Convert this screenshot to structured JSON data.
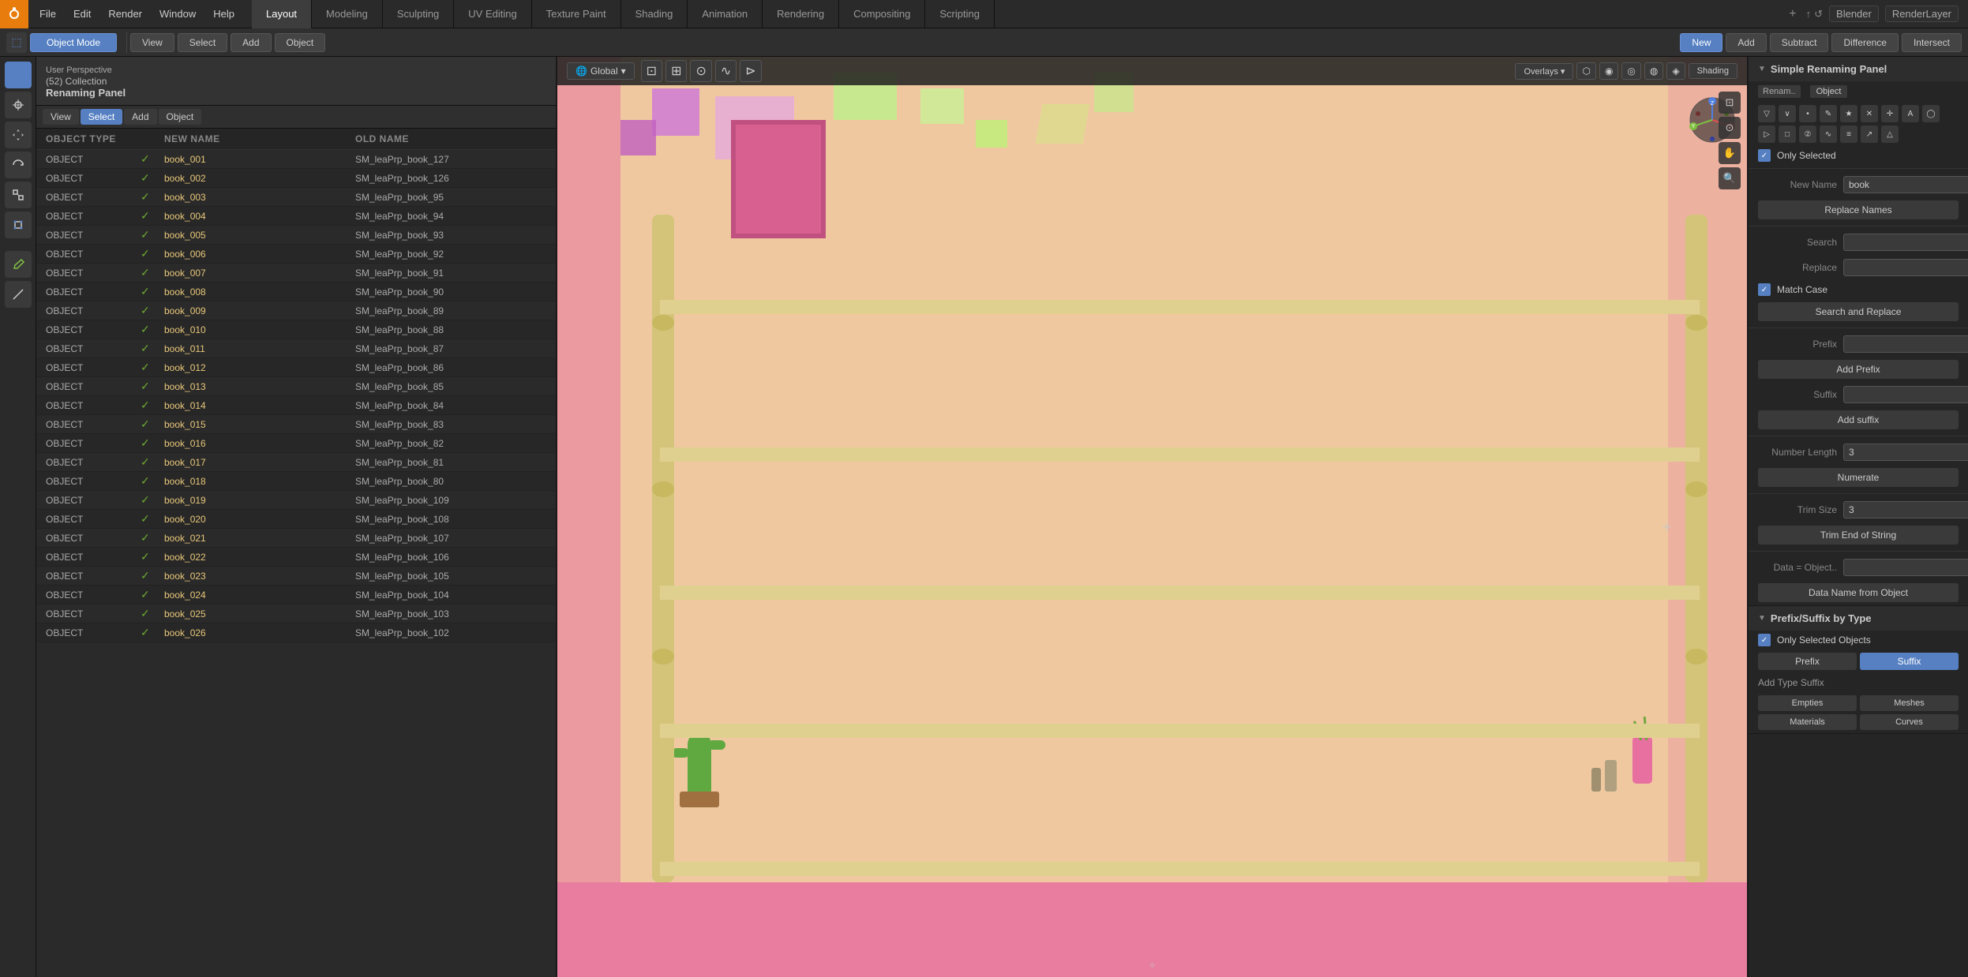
{
  "app": {
    "icon": "🟠",
    "title": "Blender"
  },
  "top_menu": {
    "items": [
      "File",
      "Edit",
      "Render",
      "Window",
      "Help"
    ]
  },
  "workspace_tabs": [
    {
      "label": "Layout",
      "active": true
    },
    {
      "label": "Modeling"
    },
    {
      "label": "Sculpting"
    },
    {
      "label": "UV Editing"
    },
    {
      "label": "Texture Paint"
    },
    {
      "label": "Shading"
    },
    {
      "label": "Animation"
    },
    {
      "label": "Rendering"
    },
    {
      "label": "Compositing"
    },
    {
      "label": "Scripting"
    }
  ],
  "header_toolbar": {
    "buttons": [
      {
        "label": "New",
        "active": true
      },
      {
        "label": "Add",
        "active": false
      },
      {
        "label": "Subtract",
        "active": false
      },
      {
        "label": "Difference",
        "active": false
      },
      {
        "label": "Intersect",
        "active": false
      }
    ]
  },
  "mode_selector": {
    "label": "Object Mode"
  },
  "view_buttons": [
    "View",
    "Select",
    "Add",
    "Object"
  ],
  "renaming_panel": {
    "header": "Renaming Panel",
    "collection_label": "(52) Collection",
    "perspective_label": "User Perspective",
    "view_buttons": [
      "View",
      "Select",
      "Add",
      "Object"
    ],
    "table_headers": {
      "object_type": "OBJECT TYPE",
      "new_name": "NEW NAME",
      "old_name": "OLD NAME"
    },
    "rows": [
      {
        "type": "OBJECT",
        "new_name": "book_001",
        "old_name": "SM_leaPrp_book_127"
      },
      {
        "type": "OBJECT",
        "new_name": "book_002",
        "old_name": "SM_leaPrp_book_126"
      },
      {
        "type": "OBJECT",
        "new_name": "book_003",
        "old_name": "SM_leaPrp_book_95"
      },
      {
        "type": "OBJECT",
        "new_name": "book_004",
        "old_name": "SM_leaPrp_book_94"
      },
      {
        "type": "OBJECT",
        "new_name": "book_005",
        "old_name": "SM_leaPrp_book_93"
      },
      {
        "type": "OBJECT",
        "new_name": "book_006",
        "old_name": "SM_leaPrp_book_92"
      },
      {
        "type": "OBJECT",
        "new_name": "book_007",
        "old_name": "SM_leaPrp_book_91"
      },
      {
        "type": "OBJECT",
        "new_name": "book_008",
        "old_name": "SM_leaPrp_book_90"
      },
      {
        "type": "OBJECT",
        "new_name": "book_009",
        "old_name": "SM_leaPrp_book_89"
      },
      {
        "type": "OBJECT",
        "new_name": "book_010",
        "old_name": "SM_leaPrp_book_88"
      },
      {
        "type": "OBJECT",
        "new_name": "book_011",
        "old_name": "SM_leaPrp_book_87"
      },
      {
        "type": "OBJECT",
        "new_name": "book_012",
        "old_name": "SM_leaPrp_book_86"
      },
      {
        "type": "OBJECT",
        "new_name": "book_013",
        "old_name": "SM_leaPrp_book_85"
      },
      {
        "type": "OBJECT",
        "new_name": "book_014",
        "old_name": "SM_leaPrp_book_84"
      },
      {
        "type": "OBJECT",
        "new_name": "book_015",
        "old_name": "SM_leaPrp_book_83"
      },
      {
        "type": "OBJECT",
        "new_name": "book_016",
        "old_name": "SM_leaPrp_book_82"
      },
      {
        "type": "OBJECT",
        "new_name": "book_017",
        "old_name": "SM_leaPrp_book_81"
      },
      {
        "type": "OBJECT",
        "new_name": "book_018",
        "old_name": "SM_leaPrp_book_80"
      },
      {
        "type": "OBJECT",
        "new_name": "book_019",
        "old_name": "SM_leaPrp_book_109"
      },
      {
        "type": "OBJECT",
        "new_name": "book_020",
        "old_name": "SM_leaPrp_book_108"
      },
      {
        "type": "OBJECT",
        "new_name": "book_021",
        "old_name": "SM_leaPrp_book_107"
      },
      {
        "type": "OBJECT",
        "new_name": "book_022",
        "old_name": "SM_leaPrp_book_106"
      },
      {
        "type": "OBJECT",
        "new_name": "book_023",
        "old_name": "SM_leaPrp_book_105"
      },
      {
        "type": "OBJECT",
        "new_name": "book_024",
        "old_name": "SM_leaPrp_book_104"
      },
      {
        "type": "OBJECT",
        "new_name": "book_025",
        "old_name": "SM_leaPrp_book_103"
      },
      {
        "type": "OBJECT",
        "new_name": "book_026",
        "old_name": "SM_leaPrp_book_102"
      }
    ]
  },
  "viewport": {
    "mode": "Global",
    "perspective": "User Perspective",
    "plus_btn": "+"
  },
  "right_panel": {
    "title": "Simple Renaming Panel",
    "renam_label": "Renam..",
    "object_label": "Object",
    "only_selected_label": "Only Selected",
    "only_selected_checked": true,
    "new_name_label": "New Name",
    "new_name_value": "book",
    "replace_names_btn": "Replace Names",
    "search_label": "Search",
    "search_value": "",
    "replace_label": "Replace",
    "replace_value": "",
    "match_case_label": "Match Case",
    "match_case_checked": true,
    "search_and_replace_btn": "Search and Replace",
    "prefix_label": "Prefix",
    "prefix_value": "",
    "add_prefix_btn": "Add Prefix",
    "suffix_label": "Suffix",
    "suffix_value": "",
    "add_suffix_btn": "Add suffix",
    "number_length_label": "Number Length",
    "number_length_value": "3",
    "numerate_btn": "Numerate",
    "trim_size_label": "Trim Size",
    "trim_size_value": "3",
    "trim_end_of_string_btn": "Trim End of String",
    "data_label": "Data = Object..",
    "data_value": "",
    "data_name_from_object_btn": "Data Name from Object",
    "prefix_suffix_by_type_label": "Prefix/Suffix by Type",
    "only_selected_objects_label": "Only Selected Objects",
    "prefix_btn": "Prefix",
    "suffix_btn": "Suffix",
    "add_type_suffix_label": "Add Type Suffix",
    "type_items": [
      "Empties",
      "Meshes",
      "Materials",
      "Curves"
    ]
  },
  "icons": {
    "arrow_down": "▼",
    "arrow_right": "▶",
    "checkmark": "✓",
    "plus": "+",
    "minus": "−",
    "checkbox_checked": "✓",
    "x_axis": "X",
    "y_axis": "Y",
    "z_axis": "Z"
  },
  "axis_colors": {
    "x": "#e05050",
    "y": "#80c040",
    "z": "#5080e0"
  }
}
